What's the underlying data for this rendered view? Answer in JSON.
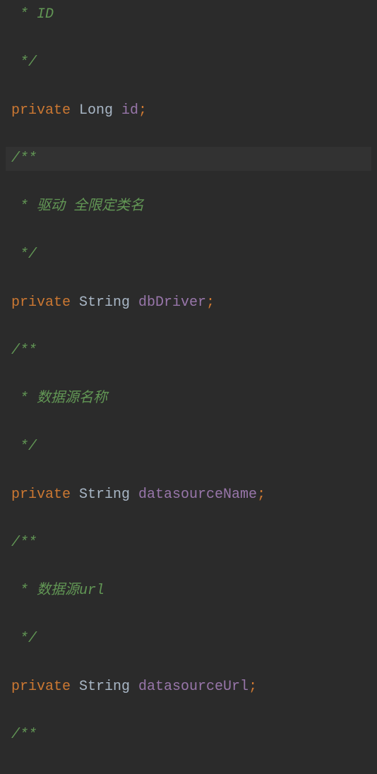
{
  "lines": [
    {
      "tokens": [
        {
          "text": " * ID",
          "cls": "comment-green"
        }
      ]
    },
    {
      "tokens": [
        {
          "text": " */",
          "cls": "comment-green"
        }
      ]
    },
    {
      "tokens": [
        {
          "text": "private ",
          "cls": "keyword normal"
        },
        {
          "text": "Long ",
          "cls": "type normal"
        },
        {
          "text": "id",
          "cls": "field normal"
        },
        {
          "text": ";",
          "cls": "semi normal"
        }
      ]
    },
    {
      "highlight": true,
      "tokens": [
        {
          "text": "/**",
          "cls": "comment-green"
        }
      ]
    },
    {
      "tokens": [
        {
          "text": " * 驱动 全限定类名",
          "cls": "comment-green"
        }
      ]
    },
    {
      "tokens": [
        {
          "text": " */",
          "cls": "comment-green"
        }
      ]
    },
    {
      "tokens": [
        {
          "text": "private ",
          "cls": "keyword normal"
        },
        {
          "text": "String ",
          "cls": "type normal"
        },
        {
          "text": "dbDriver",
          "cls": "field normal"
        },
        {
          "text": ";",
          "cls": "semi normal"
        }
      ]
    },
    {
      "tokens": [
        {
          "text": "/**",
          "cls": "comment-green"
        }
      ]
    },
    {
      "tokens": [
        {
          "text": " * 数据源名称",
          "cls": "comment-green"
        }
      ]
    },
    {
      "tokens": [
        {
          "text": " */",
          "cls": "comment-green"
        }
      ]
    },
    {
      "tokens": [
        {
          "text": "private ",
          "cls": "keyword normal"
        },
        {
          "text": "String ",
          "cls": "type normal"
        },
        {
          "text": "datasourceName",
          "cls": "field normal"
        },
        {
          "text": ";",
          "cls": "semi normal"
        }
      ]
    },
    {
      "tokens": [
        {
          "text": "/**",
          "cls": "comment-green"
        }
      ]
    },
    {
      "tokens": [
        {
          "text": " * 数据源url",
          "cls": "comment-green"
        }
      ]
    },
    {
      "tokens": [
        {
          "text": " */",
          "cls": "comment-green"
        }
      ]
    },
    {
      "tokens": [
        {
          "text": "private ",
          "cls": "keyword normal"
        },
        {
          "text": "String ",
          "cls": "type normal"
        },
        {
          "text": "datasourceUrl",
          "cls": "field normal"
        },
        {
          "text": ";",
          "cls": "semi normal"
        }
      ]
    },
    {
      "tokens": [
        {
          "text": "/**",
          "cls": "comment-green"
        }
      ]
    }
  ]
}
